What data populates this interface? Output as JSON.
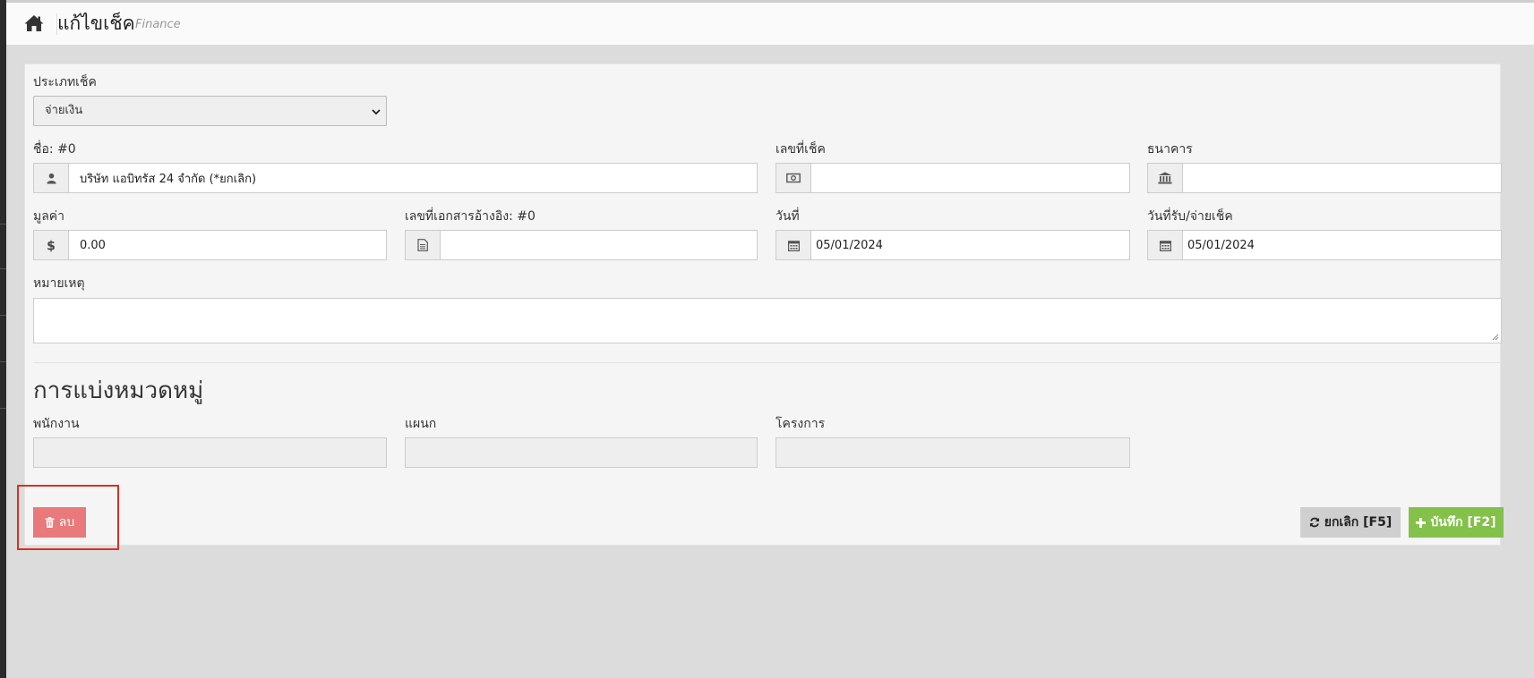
{
  "header": {
    "title": "แก้ไขเช็ค",
    "subtitle": "Finance",
    "home_icon": "home-icon"
  },
  "form": {
    "check_type": {
      "label": "ประเภทเช็ค",
      "value": "จ่ายเงิน"
    },
    "name": {
      "label": "ชื่อ: #0",
      "value": "บริษัท แอบิทรัส 24 จำกัด (*ยกเลิก)",
      "icon": "user-icon"
    },
    "check_number": {
      "label": "เลขที่เช็ค",
      "value": "",
      "icon": "money-icon"
    },
    "bank": {
      "label": "ธนาคาร",
      "value": "",
      "icon": "bank-icon"
    },
    "amount": {
      "label": "มูลค่า",
      "value": "0.00",
      "icon": "dollar-icon"
    },
    "ref_doc": {
      "label": "เลขที่เอกสารอ้างอิง: #0",
      "value": "",
      "icon": "file-icon"
    },
    "date": {
      "label": "วันที่",
      "value": "05/01/2024",
      "icon": "calendar-icon"
    },
    "receive_date": {
      "label": "วันที่รับ/จ่ายเช็ค",
      "value": "05/01/2024",
      "icon": "calendar-icon"
    },
    "note": {
      "label": "หมายเหตุ",
      "value": ""
    }
  },
  "category": {
    "title": "การแบ่งหมวดหมู่",
    "employee_label": "พนักงาน",
    "department_label": "แผนก",
    "project_label": "โครงการ"
  },
  "buttons": {
    "delete": "ลบ",
    "cancel": "ยกเลิก [F5]",
    "save": "บันทึก [F2]"
  },
  "colors": {
    "delete": "#e9797a",
    "save": "#83c14b",
    "cancel": "#cfcfcf",
    "highlight": "#d93025"
  }
}
